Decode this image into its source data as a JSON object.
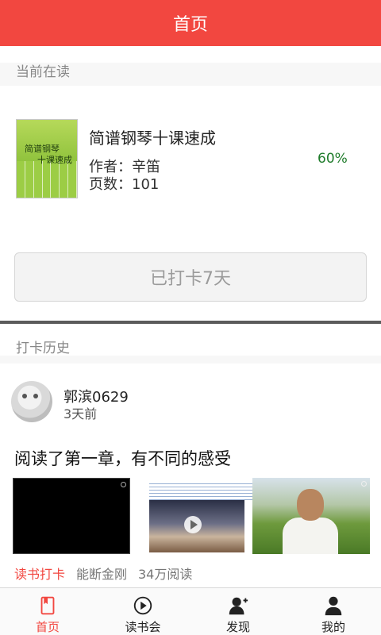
{
  "header": {
    "title": "首页"
  },
  "current_reading": {
    "section_label": "当前在读",
    "cover": {
      "title_line1": "简谱钢琴",
      "title_line2": "十课速成"
    },
    "book_title": "简谱钢琴十课速成",
    "author": "作者：辛笛",
    "pages": "页数：101",
    "progress": "60%",
    "checkin_button": "已打卡7天"
  },
  "history": {
    "section_label": "打卡历史",
    "post": {
      "username": "郭滨0629",
      "time_ago": "3天前",
      "text": "阅读了第一章，有不同的感受",
      "tag": "读书打卡",
      "source": "能断金刚",
      "reads": "34万阅读"
    }
  },
  "tabbar": {
    "items": [
      {
        "label": "首页",
        "icon": "book-icon",
        "active": true
      },
      {
        "label": "读书会",
        "icon": "play-circle-icon",
        "active": false
      },
      {
        "label": "发现",
        "icon": "add-user-icon",
        "active": false
      },
      {
        "label": "我的",
        "icon": "person-icon",
        "active": false
      }
    ]
  },
  "colors": {
    "accent": "#f24740",
    "progress": "#1e7b2a"
  }
}
